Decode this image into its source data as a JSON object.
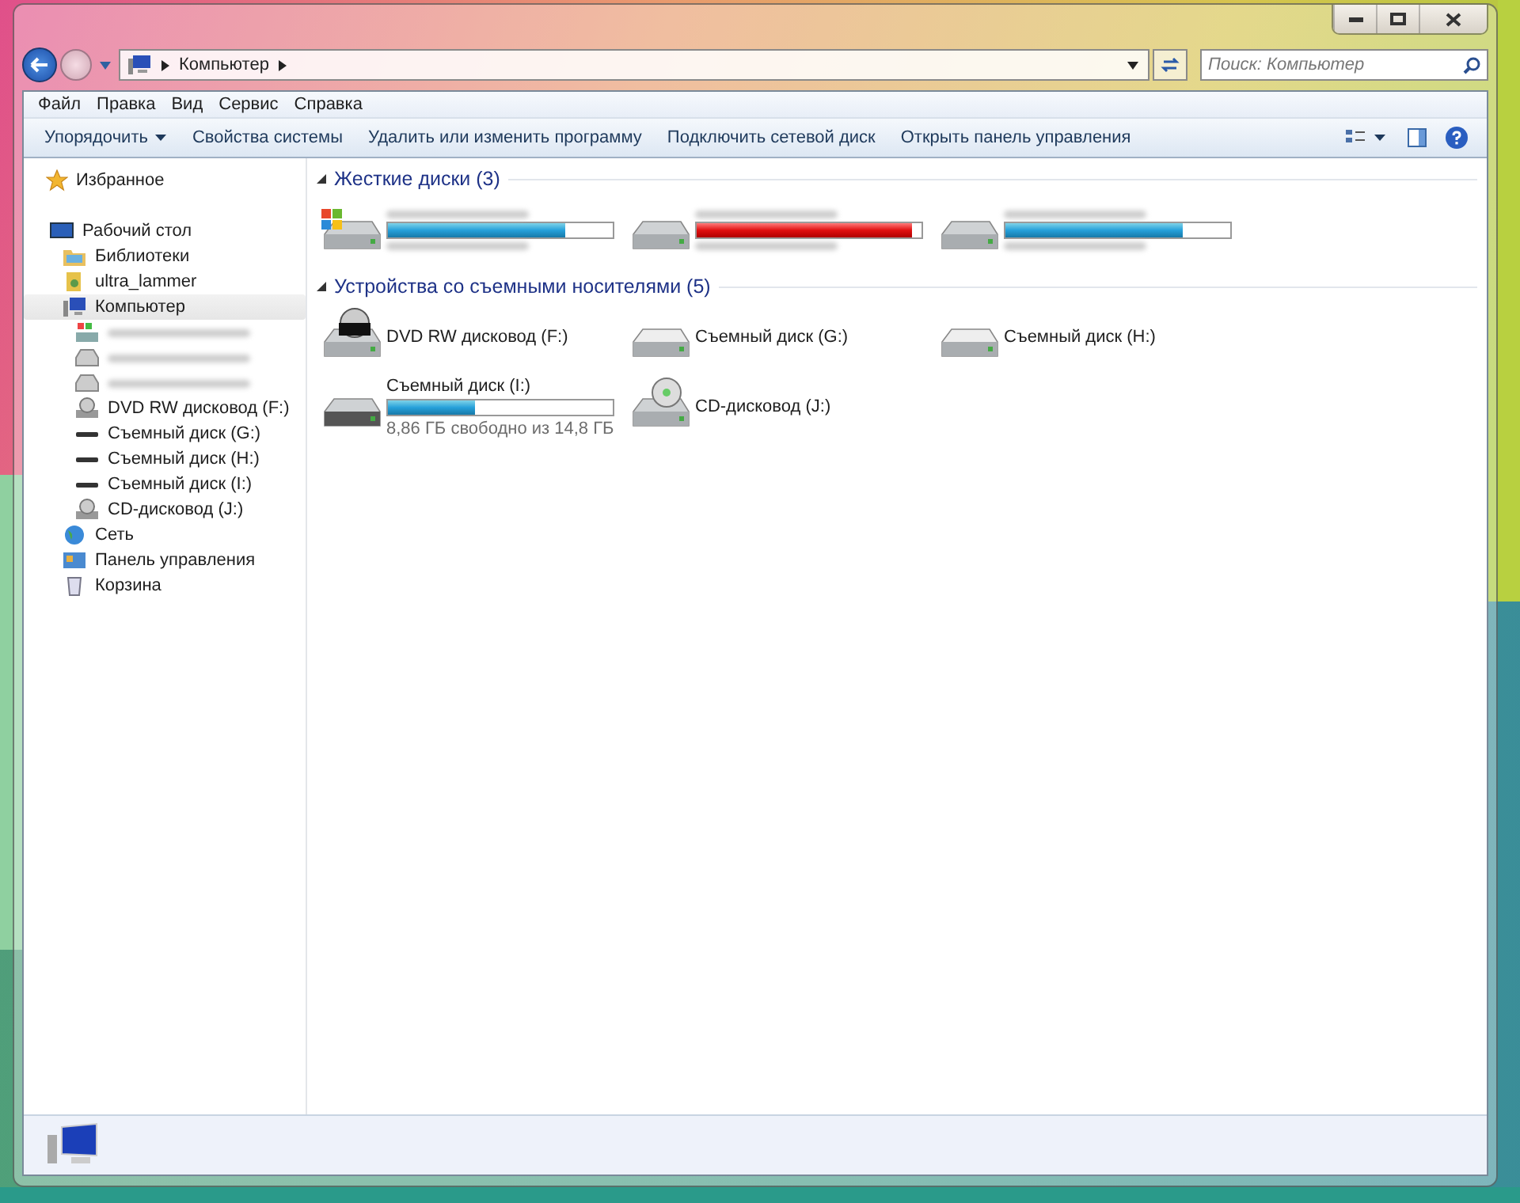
{
  "navigation": {
    "address": [
      "Компьютер"
    ],
    "search": {
      "placeholder": "Поиск: Компьютер"
    }
  },
  "menu": [
    "Файл",
    "Правка",
    "Вид",
    "Сервис",
    "Справка"
  ],
  "toolbar": [
    {
      "label": "Упорядочить",
      "dropdown": true
    },
    {
      "label": "Свойства системы",
      "dropdown": false
    },
    {
      "label": "Удалить или изменить программу",
      "dropdown": false
    },
    {
      "label": "Подключить сетевой диск",
      "dropdown": false
    },
    {
      "label": "Открыть панель управления",
      "dropdown": false
    }
  ],
  "sidebar": {
    "favorites": "Избранное",
    "tree": [
      {
        "label": "Рабочий стол",
        "kind": "desktop",
        "selected": false,
        "children": [
          {
            "label": "Библиотеки",
            "kind": "library",
            "selected": false
          },
          {
            "label": "ultra_lammer",
            "kind": "user",
            "selected": false
          },
          {
            "label": "Компьютер",
            "kind": "computer",
            "selected": true,
            "children": [
              {
                "kind": "windrive",
                "selected": false
              },
              {
                "kind": "drive",
                "selected": false
              },
              {
                "kind": "drive",
                "selected": false
              },
              {
                "label": "DVD RW дисковод (F:)",
                "kind": "optical",
                "selected": false
              },
              {
                "label": "Съемный диск (G:)",
                "kind": "removable",
                "selected": false
              },
              {
                "label": "Съемный диск (H:)",
                "kind": "removable",
                "selected": false
              },
              {
                "label": "Съемный диск (I:)",
                "kind": "removable",
                "selected": false
              },
              {
                "label": "CD-дисковод (J:)",
                "kind": "optical",
                "selected": false
              }
            ]
          },
          {
            "label": "Сеть",
            "kind": "network",
            "selected": false
          },
          {
            "label": "Панель управления",
            "kind": "control",
            "selected": false
          },
          {
            "label": "Корзина",
            "kind": "recycle",
            "selected": false
          }
        ]
      }
    ]
  },
  "groups": [
    {
      "title": "Жесткие диски (3)",
      "expanded": true,
      "items": [
        {
          "kind": "system",
          "level": 0.79,
          "critical": false
        },
        {
          "kind": "hdd",
          "level": 0.96,
          "critical": true
        },
        {
          "kind": "hdd",
          "level": 0.79,
          "critical": false
        }
      ]
    },
    {
      "title": "Устройства со съемными носителями (5)",
      "expanded": true,
      "items": [
        {
          "kind": "dvd",
          "name": "DVD RW дисковод (F:)"
        },
        {
          "kind": "empty",
          "name": "Съемный диск (G:)"
        },
        {
          "kind": "empty",
          "name": "Съемный диск (H:)"
        },
        {
          "kind": "removable",
          "name": "Съемный диск (I:)",
          "level": 0.39,
          "critical": false,
          "info": "8,86 ГБ свободно из 14,8 ГБ"
        },
        {
          "kind": "cd",
          "name": "CD-дисковод (J:)"
        }
      ]
    }
  ]
}
